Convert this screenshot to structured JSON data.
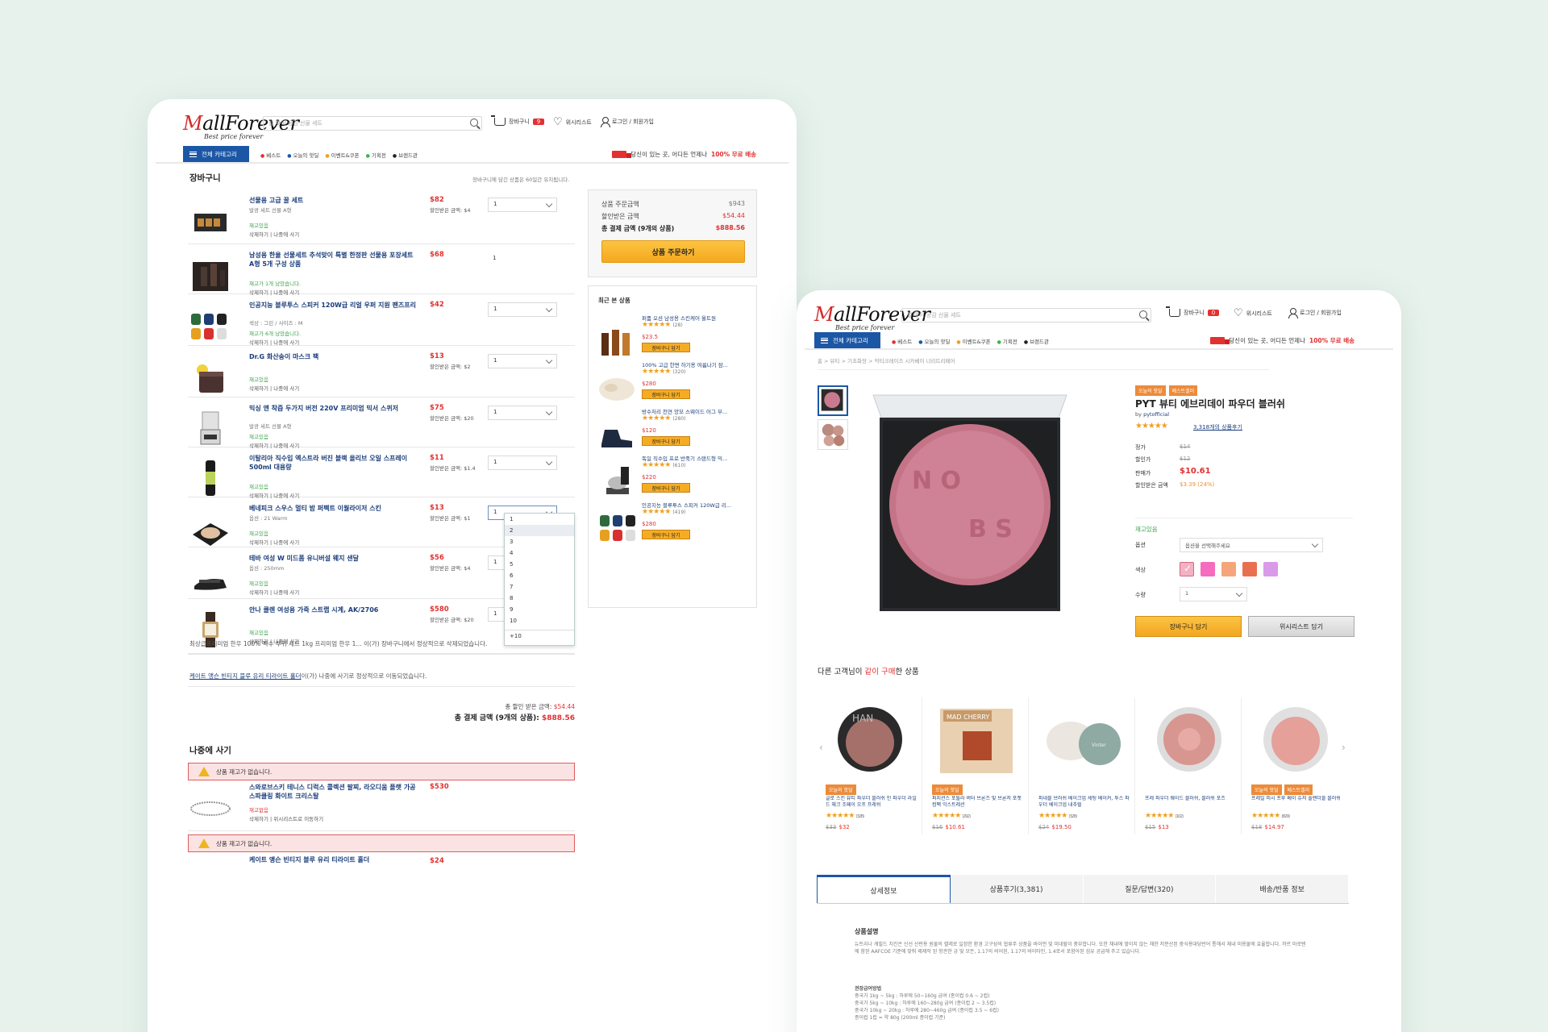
{
  "cart_page": {
    "logo": {
      "main": "MallForever",
      "tagline": "Best price forever"
    },
    "search_placeholder": "설 맞이 공감 선물 세트",
    "header": {
      "cart_label": "장바구니",
      "cart_count": "9",
      "wishlist_label": "위시리스트",
      "login_label": "로그인 / 회원가입"
    },
    "nav": {
      "all_categories": "전체 카테고리",
      "links": [
        "베스트",
        "오늘의 핫딜",
        "이벤트&쿠폰",
        "기획전",
        "브랜드관"
      ],
      "promo_text": "당신이 있는 곳, 어디든 언제나",
      "promo_highlight": "100% 무료 배송"
    },
    "cart_title": "장바구니",
    "cart_note": "장바구니에 담긴 상품은 60일간 유지됩니다.",
    "items": [
      {
        "name": "선물용 고급 꿀 세트",
        "option": "발광 세트 선물 A형",
        "price": "$82",
        "discount": "할인받은 금액: $4",
        "stock": "재고있음",
        "actions": "삭제하기 | 나중에 사기",
        "qty": "1",
        "select": true
      },
      {
        "name": "남성용 한율 선물세트 추석맞이 특별 한정판 선물용 포장세트 A형 5개 구성 상품",
        "option": "",
        "price": "$68",
        "discount": "",
        "stock": "재고가 1개 남았습니다.",
        "actions": "삭제하기 | 나중에 사기",
        "qty": "1",
        "select": false
      },
      {
        "name": "인공지능 블루투스 스피커 120W급 리얼 우퍼 지원 팬즈프리",
        "option": "색상 : 그린 / 사이즈 : M",
        "price": "$42",
        "discount": "",
        "stock": "재고가 6개 남았습니다.",
        "actions": "삭제하기 | 나중에 사기",
        "qty": "1",
        "select": true
      },
      {
        "name": "Dr.G 화산송이 마스크 팩",
        "option": "",
        "price": "$13",
        "discount": "할인받은 금액: $2",
        "stock": "재고있음",
        "actions": "삭제하기 | 나중에 사기",
        "qty": "1",
        "select": true
      },
      {
        "name": "믹싱 앤 착즙 두가지 버전 220V 프리미엄 믹서 스퀴저",
        "option": "발광 세트 선물 A형",
        "price": "$75",
        "discount": "할인받은 금액: $20",
        "stock": "재고있음",
        "actions": "삭제하기 | 나중에 사기",
        "qty": "1",
        "select": true
      },
      {
        "name": "이탈리아 직수입 엑스트라 버진 블랙 올리브 오일 스프레이 500ml 대용량",
        "option": "",
        "price": "$11",
        "discount": "할인받은 금액: $1.4",
        "stock": "재고있음",
        "actions": "삭제하기 | 나중에 사기",
        "qty": "1",
        "select": true
      },
      {
        "name": "베네피크 스우스 멀티 밤 퍼펙트 이월라이저 스킨",
        "option": "옵션 : 21 Warm",
        "price": "$13",
        "discount": "할인받은 금액: $1",
        "stock": "재고있음",
        "actions": "삭제하기 | 나중에 사기",
        "qty": "1",
        "select": true
      },
      {
        "name": "테바 여성 W 미드폼 유니버설 웨지 샌달",
        "option": "옵션 : 250mm",
        "price": "$56",
        "discount": "할인받은 금액: $4",
        "stock": "재고있음",
        "actions": "삭제하기 | 나중에 사기",
        "qty": "1",
        "select": true
      },
      {
        "name": "안나 클렌 여성용 가죽 스트랩 시계, AK/2706",
        "option": "",
        "price": "$580",
        "discount": "할인받은 금액: $20",
        "stock": "재고있음",
        "actions": "삭제하기 | 나중에 사기",
        "qty": "1",
        "select": true
      }
    ],
    "dropdown_options": [
      "1",
      "2",
      "3",
      "4",
      "5",
      "6",
      "7",
      "8",
      "9",
      "10",
      "+10"
    ],
    "summary": {
      "order_amount_label": "상품 주문금액",
      "order_amount": "$943",
      "discount_label": "할인받은 금액",
      "discount": "$54.44",
      "total_label": "총 결제 금액 (9개의 상품)",
      "total": "$888.56",
      "order_button": "상품 주문하기"
    },
    "recent": {
      "title": "최근 본 상품",
      "items": [
        {
          "name": "퍼퓸 오션 남성용 스킨케어 올트원",
          "reviews": "(28)",
          "price": "$23.5",
          "button": "장바구니 담기"
        },
        {
          "name": "100% 고급 한면 하기용 여름나기 잠...",
          "reviews": "(320)",
          "price": "$280",
          "button": "장바구니 담기"
        },
        {
          "name": "방수처리 천연 양모 스웨이드 어그 부...",
          "reviews": "(280)",
          "price": "$120",
          "button": "장바구니 담기"
        },
        {
          "name": "독일 직수입 프로 반죽기 스탠드형 믹...",
          "reviews": "(610)",
          "price": "$220",
          "button": "장바구니 담기"
        },
        {
          "name": "인공지능 블루투스 스피커 120W급 리...",
          "reviews": "(419)",
          "price": "$280",
          "button": "장바구니 담기"
        }
      ]
    },
    "messages": [
      {
        "text": "최상급프리미엄 한우 100% 특수 부위 세트 1kg 프리미엄 한우 1... 이(가) 장바구니에서 정상적으로 삭제되었습니다.",
        "link": ""
      },
      {
        "link": "케이트 앵슨 빈티지 블루 유리 티라이트 홀더",
        "text": "이(가) 나중에 사기로 정상적으로 이동되었습니다."
      }
    ],
    "totals": {
      "discount_label": "총 할인 받은 금액:",
      "discount": "$54.44",
      "total_label": "총 결제 금액 (9개의 상품):",
      "total": "$888.56"
    },
    "later": {
      "title": "나중에 사기",
      "alert": "상품 재고가 없습니다.",
      "item": {
        "name": "스와로브스키 테니스 디럭스 콜렉션 팔찌, 라오디움 플랫 가공 스파클링 화이트 크리스탈",
        "price": "$530",
        "stock": "재고없음",
        "actions": "삭제하기 | 위시리스트로 이동하기"
      },
      "alert2": "상품 재고가 없습니다.",
      "item2": {
        "name": "케이트 앵슨 빈티지 블루 유리 티라이트 홀더",
        "price": "$24"
      }
    }
  },
  "product_page": {
    "breadcrumb": "홈 > 뷰티 > 기초화장 > 악티크레이즈 시카베이 너리트리페어",
    "tags": [
      "오늘의 핫딜",
      "베스트셀러"
    ],
    "title": "PYT 뷰티 에브리데이 파우더 블러쉬",
    "by": "by",
    "seller": "pytofficial",
    "rating": 4.5,
    "reviews_link": "3,318개의 상품후기",
    "info": [
      {
        "label": "정가",
        "value": "$14"
      },
      {
        "label": "할인가",
        "value": "$12"
      },
      {
        "label": "판매가",
        "value": "$10.61"
      },
      {
        "label": "할인받은 금액",
        "value": "$3.39 (24%)"
      }
    ],
    "stock": "재고있음",
    "option_label": "옵션",
    "option_value": "옵션을 선택해주세요",
    "color_label": "색상",
    "colors": [
      "#f4b1c3",
      "#f56bbf",
      "#f5a57a",
      "#e9704f",
      "#d99ae8"
    ],
    "qty_label": "수량",
    "qty_value": "1",
    "image_text": "NO BS",
    "cart_button": "장바구니 담기",
    "wish_button": "위시리스트 담기",
    "also_bought": {
      "prefix": "다른 고객님이 ",
      "highlight": "같이 구매",
      "suffix": "한 상품"
    },
    "alts": [
      {
        "tags": [
          "오늘의 핫딜"
        ],
        "name": "글로 스킨 뷰티 파우더 블러쉬 인 파우더 라일드 체크 조페이 오프 프레쉬",
        "reviews": "(328)",
        "old": "$33",
        "price": "$32",
        "label": "HAN"
      },
      {
        "tags": [
          "오늘의 핫딜"
        ],
        "name": "퍼지션스 포틀라 버터 브론즈 및 브론저 포켓 컴팩 익스트레션",
        "reviews": "(292)",
        "old": "$16",
        "price": "$10.61",
        "label": "MAD CHERRY"
      },
      {
        "tags": [],
        "name": "피네블 브러쉬 베이크업 세팅 베이커, 투스 파우더 베이크업 내추럴",
        "reviews": "(328)",
        "old": "$24",
        "price": "$19.50",
        "label": "Vinter"
      },
      {
        "tags": [],
        "name": "프레 파우더 웨이드 블러쉬, 블러쉬 포즈",
        "reviews": "(102)",
        "old": "$15",
        "price": "$13",
        "label": ""
      },
      {
        "tags": [
          "오늘의 핫딜",
          "베스트셀러"
        ],
        "name": "프레일 피시 프루 베이 슈저 플랜더블 블러쉬",
        "reviews": "(829)",
        "old": "$18",
        "price": "$14.97",
        "label": ""
      }
    ],
    "tabs": [
      "상세정보",
      "상품후기(3,381)",
      "질문/답변(320)",
      "배송/반품 정보"
    ],
    "desc_title": "상품설명",
    "desc_text": "뉴트리나 캐필드 치킨은 신선 산란용 원물의 캘레로 일정한 환경 고구성의 협류주 상품을 바이먼 및 미네랄이 풍부합니다. 또한 채내에 쌓이지 않는 채한 저분산된 중식용대당반어 통해서 체내 미용물에 효율합니다. 까르 마로텐에 함된 AAFCOE 기준에 맞춰 제제작 된 항관한 긍 및 모든, 1.17의 비어된, 1.17의 바이타민, 1.4로서 포함아된 섬유 공급해 주고 있습니다.",
    "desc_list": [
      "권장급여방법",
      "중국가 1kg ~ 5kg : 하루에 50~160g 급여 (종이컵 0.6 ~ 2컵)",
      "중국가 5kg ~ 10kg : 하루에 160~280g 급여 (종이컵 2 ~ 3.5컵)",
      "중국가 10kg ~ 20kg : 하루에 280~460g 급여 (종이컵 3.5 ~ 6컵)",
      "종이컵 1컵 = 약 80g (200ml 종이컵 기준)"
    ]
  }
}
